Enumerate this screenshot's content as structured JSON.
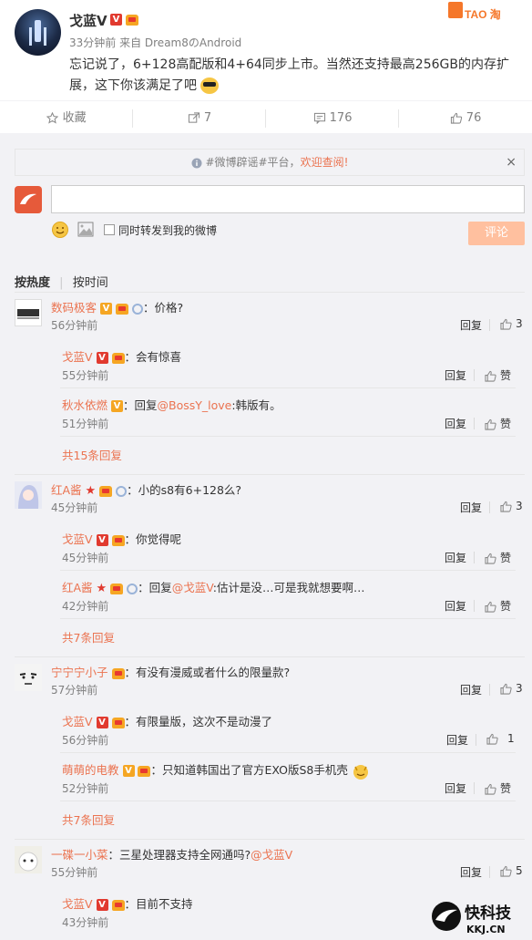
{
  "post": {
    "author": "戈蓝V",
    "meta": "33分钟前 来自 Dream8のAndroid",
    "text": "忘记说了，6+128高配版和4+64同步上市。当然还支持最高256GB的内存扩展，这下你该满足了吧",
    "brand_logo_text": "TAO 淘起来"
  },
  "actions": {
    "favorite": "收藏",
    "repost": "7",
    "comment": "176",
    "like": "76"
  },
  "notice": {
    "text_prefix": "#微博辟谣#平台，",
    "text_link": "欢迎查阅!",
    "close": "×"
  },
  "composer": {
    "repost_label": "同时转发到我的微博",
    "submit": "评论"
  },
  "sort": {
    "hot": "按热度",
    "time": "按时间"
  },
  "comments": [
    {
      "name": "数码极客",
      "text": "：价格?",
      "time": "56分钟前",
      "reply": "回复",
      "likes": "3",
      "replies": [
        {
          "name": "戈蓝V",
          "text": "：会有惊喜",
          "time": "55分钟前",
          "reply": "回复",
          "likes": "赞"
        },
        {
          "name": "秋水依燃",
          "text_prefix": "：回复",
          "mention": "@BossY_love",
          "text": ":韩版有。",
          "time": "51分钟前",
          "reply": "回复",
          "likes": "赞"
        }
      ],
      "more": "共15条回复"
    },
    {
      "name": "红A酱",
      "text": "：小的s8有6+128么?",
      "time": "45分钟前",
      "reply": "回复",
      "likes": "3",
      "replies": [
        {
          "name": "戈蓝V",
          "text": "：你觉得呢",
          "time": "45分钟前",
          "reply": "回复",
          "likes": "赞"
        },
        {
          "name": "红A酱",
          "text_prefix": "：回复",
          "mention": "@戈蓝V",
          "text": ":估计是没…可是我就想要啊…",
          "time": "42分钟前",
          "reply": "回复",
          "likes": "赞"
        }
      ],
      "more": "共7条回复"
    },
    {
      "name": "宁宁宁小子",
      "text": "：有没有漫威或者什么的限量款?",
      "time": "57分钟前",
      "reply": "回复",
      "likes": "3",
      "replies": [
        {
          "name": "戈蓝V",
          "text": "：有限量版，这次不是动漫了",
          "time": "56分钟前",
          "reply": "回复",
          "likes": "1"
        },
        {
          "name": "萌萌的电教",
          "text": "：只知道韩国出了官方EXO版S8手机壳",
          "time": "52分钟前",
          "reply": "回复",
          "likes": "赞"
        }
      ],
      "more": "共7条回复"
    },
    {
      "name": "一碟一小菜",
      "text": "：三星处理器支持全网通吗?",
      "mention": "@戈蓝V",
      "time": "55分钟前",
      "reply": "回复",
      "likes": "5",
      "replies": [
        {
          "name": "戈蓝V",
          "text": "：目前不支持",
          "time": "43分钟前"
        }
      ]
    }
  ],
  "watermark": {
    "cn": "快科技",
    "en": "KKJ.CN"
  },
  "colors": {
    "accent": "#eb7350",
    "background_feed": "#f2f2f5",
    "submit_disabled": "#ffc09f"
  }
}
